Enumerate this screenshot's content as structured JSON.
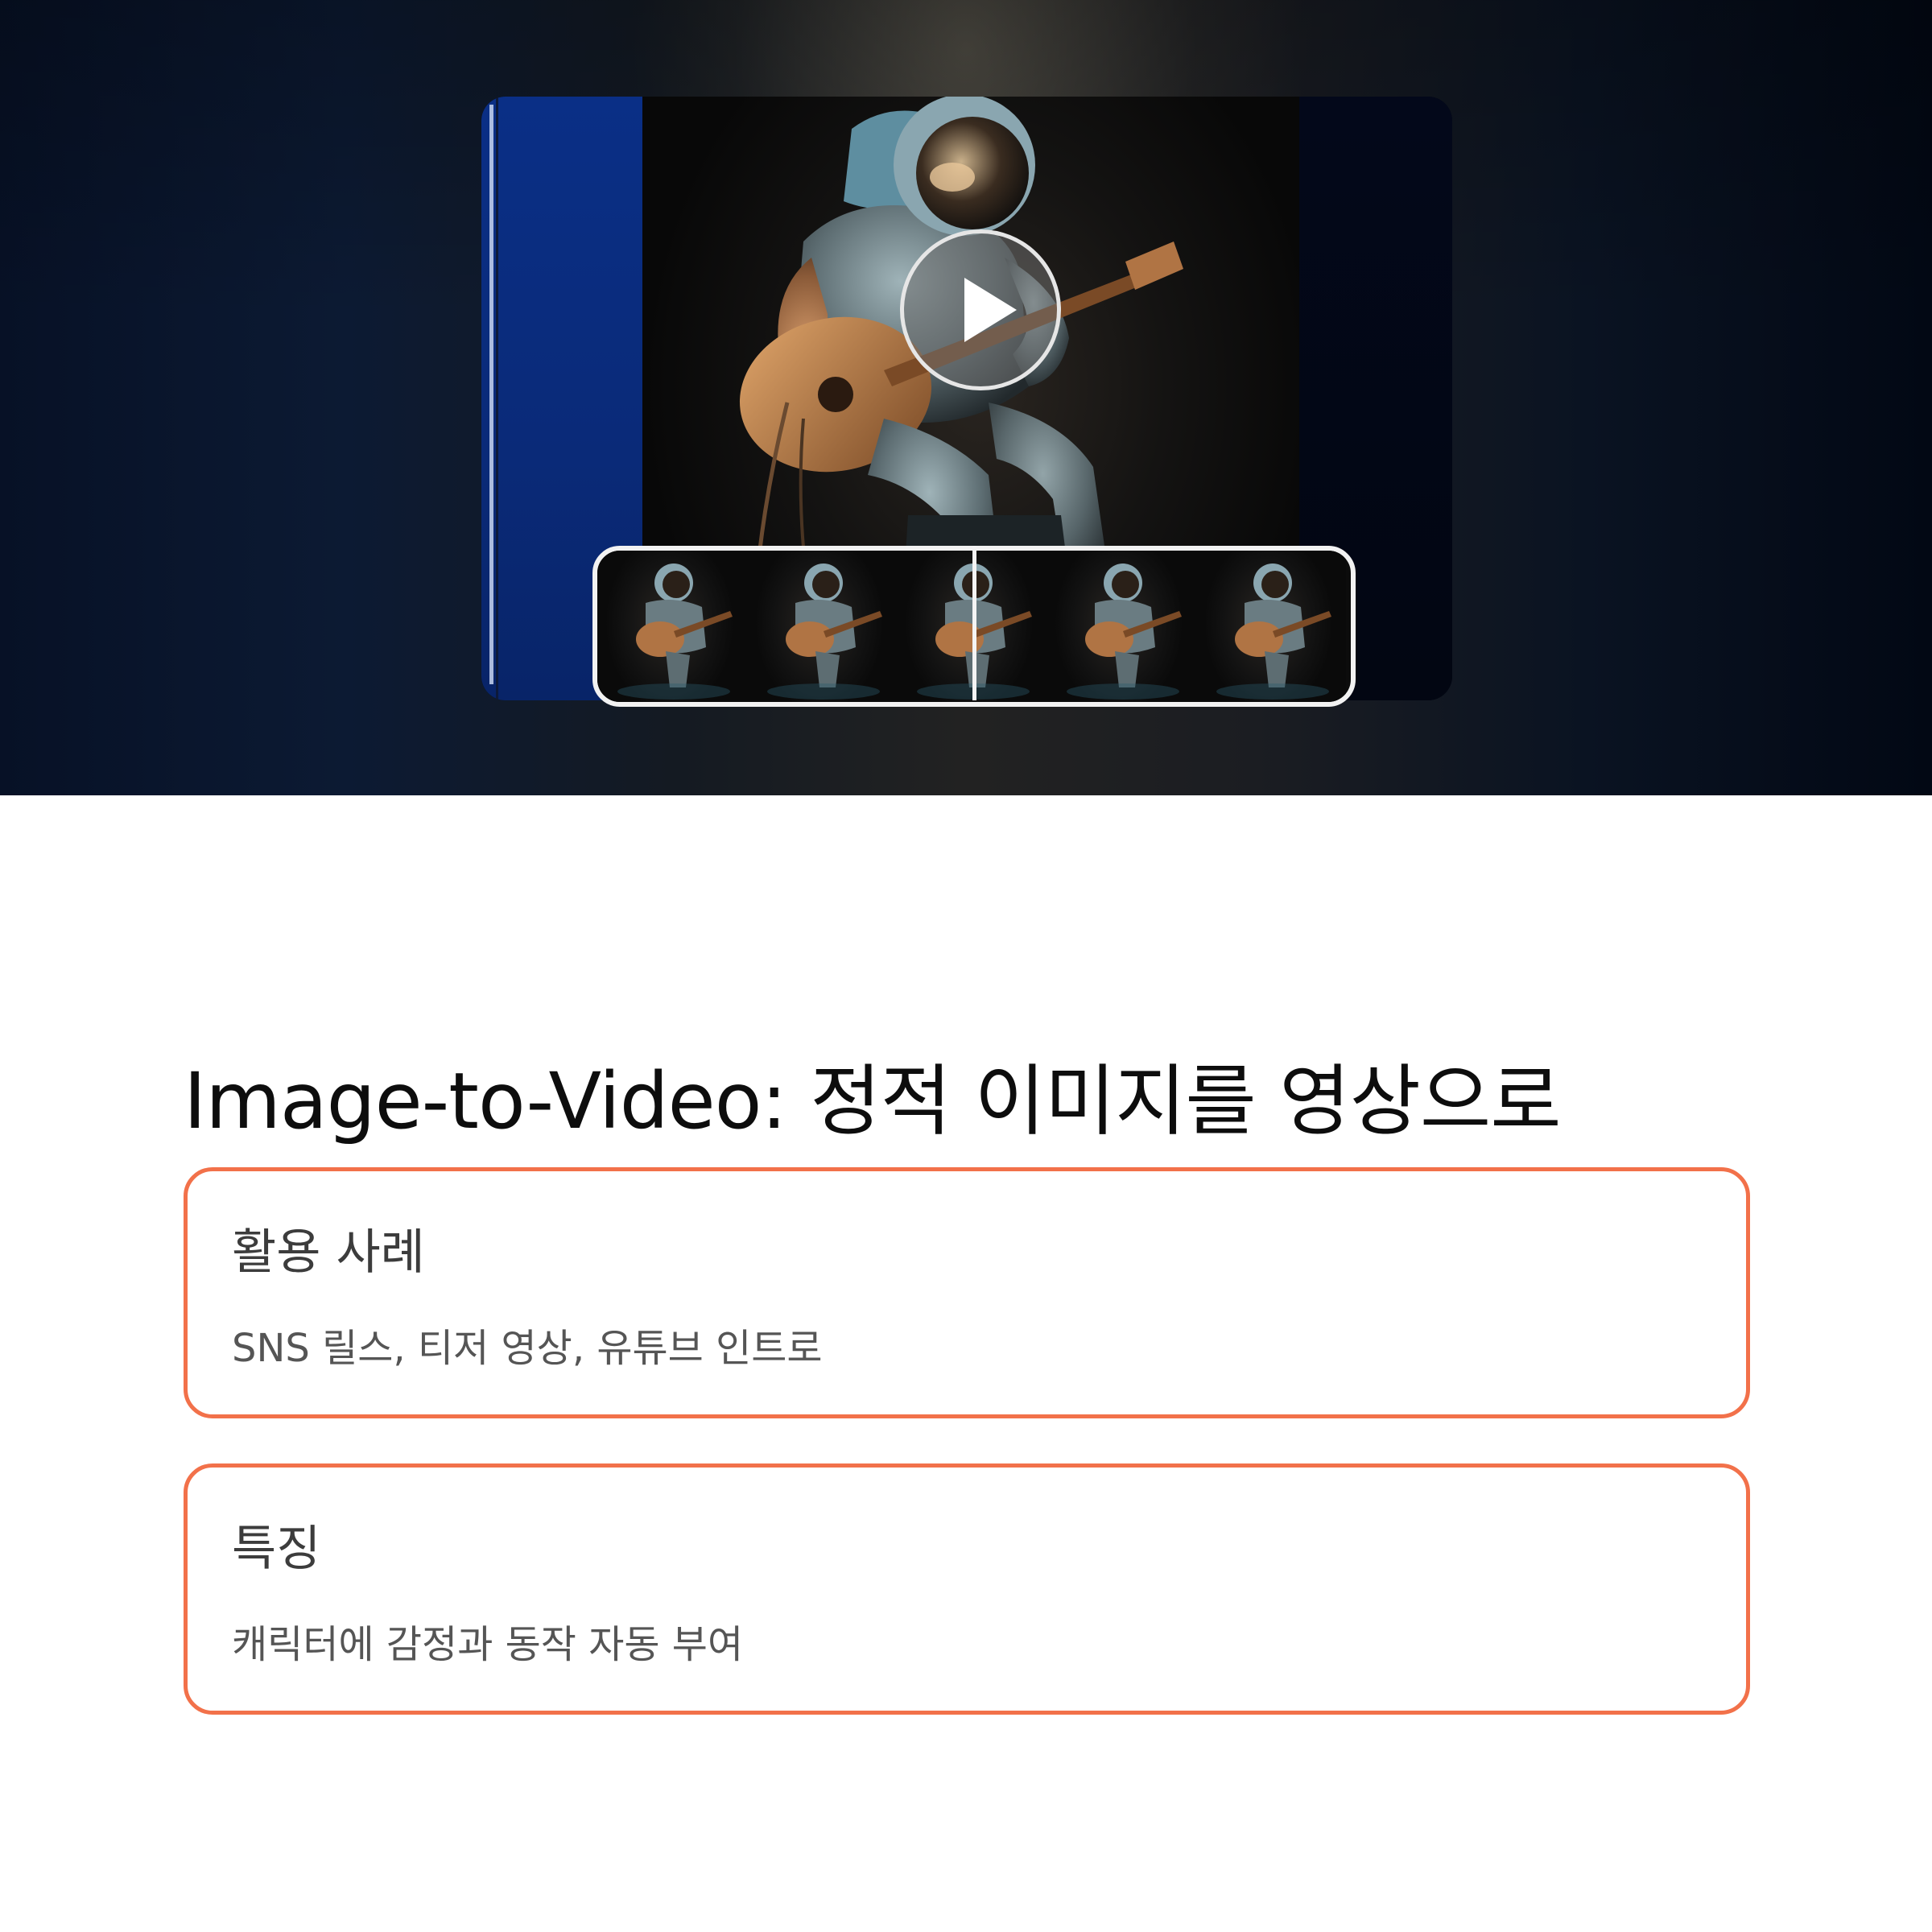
{
  "media": {
    "play_icon": "play-icon",
    "subject": "astronaut-playing-guitar",
    "thumbnail_count": 5
  },
  "page": {
    "title": "Image-to-Video: 정적 이미지를 영상으로"
  },
  "cards": [
    {
      "title": "활용 사례",
      "description": "SNS 릴스, 티저 영상, 유튜브 인트로"
    },
    {
      "title": "특징",
      "description": "캐릭터에 감정과 동작 자동 부여"
    }
  ],
  "colors": {
    "card_border": "#f2714a",
    "title_text": "#0d0d0d",
    "card_title_text": "#3c3c3c",
    "card_desc_text": "#555555"
  }
}
